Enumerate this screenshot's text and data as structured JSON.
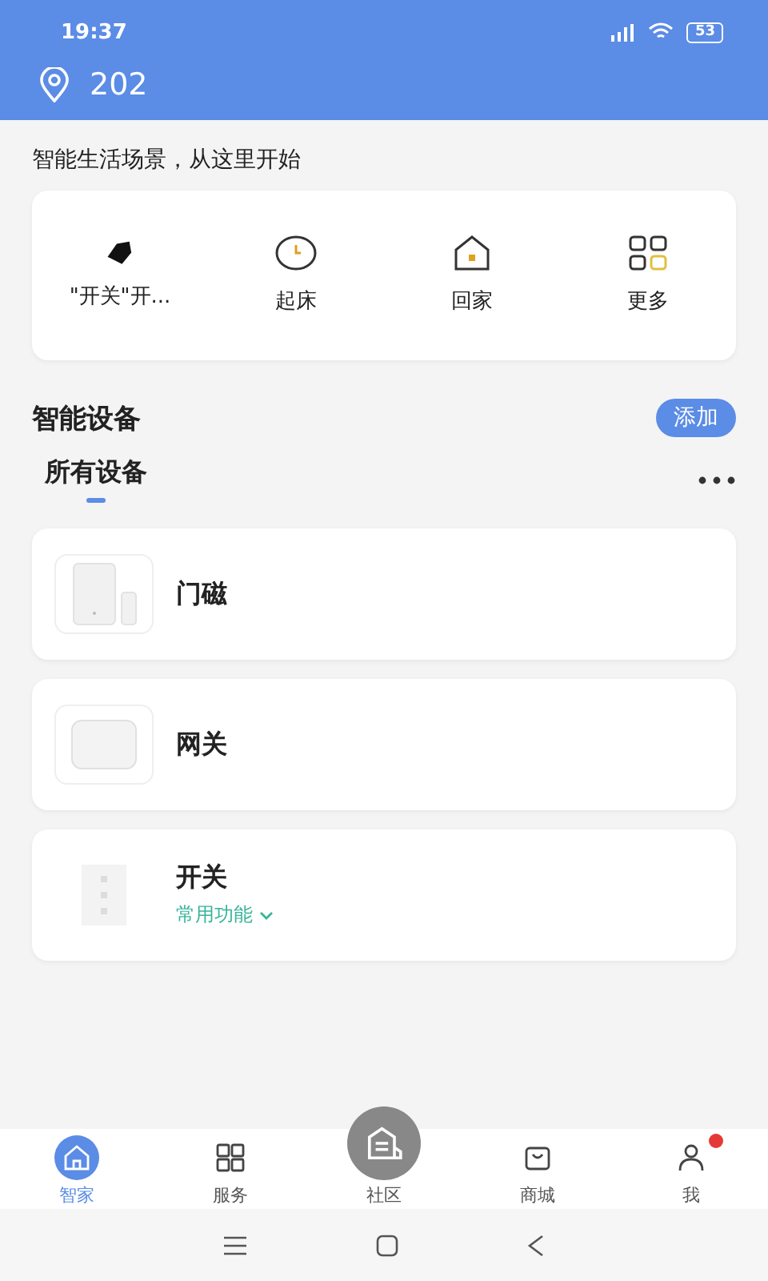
{
  "status_bar": {
    "time": "19:37",
    "battery": "53"
  },
  "header": {
    "location": "202"
  },
  "scenes_heading": "智能生活场景，从这里开始",
  "scenes": [
    {
      "kind": "tag",
      "label": "\"开关\"开..."
    },
    {
      "kind": "clock",
      "label": "起床"
    },
    {
      "kind": "home",
      "label": "回家"
    },
    {
      "kind": "grid",
      "label": "更多"
    }
  ],
  "devices_section": {
    "title": "智能设备",
    "add_button": "添加"
  },
  "device_tabs": [
    {
      "label": "所有设备",
      "selected": true
    }
  ],
  "devices": [
    {
      "kind": "door-sensor",
      "name": "门磁"
    },
    {
      "kind": "gateway",
      "name": "网关"
    },
    {
      "kind": "switch",
      "name": "开关",
      "subtitle": "常用功能"
    }
  ],
  "bottom_nav": [
    {
      "kind": "home",
      "label": "智家",
      "selected": true,
      "badge": false
    },
    {
      "kind": "grid",
      "label": "服务",
      "selected": false,
      "badge": false
    },
    {
      "kind": "community",
      "label": "社区",
      "selected": false,
      "badge": false
    },
    {
      "kind": "shop",
      "label": "商城",
      "selected": false,
      "badge": false
    },
    {
      "kind": "user",
      "label": "我",
      "selected": false,
      "badge": true
    }
  ]
}
